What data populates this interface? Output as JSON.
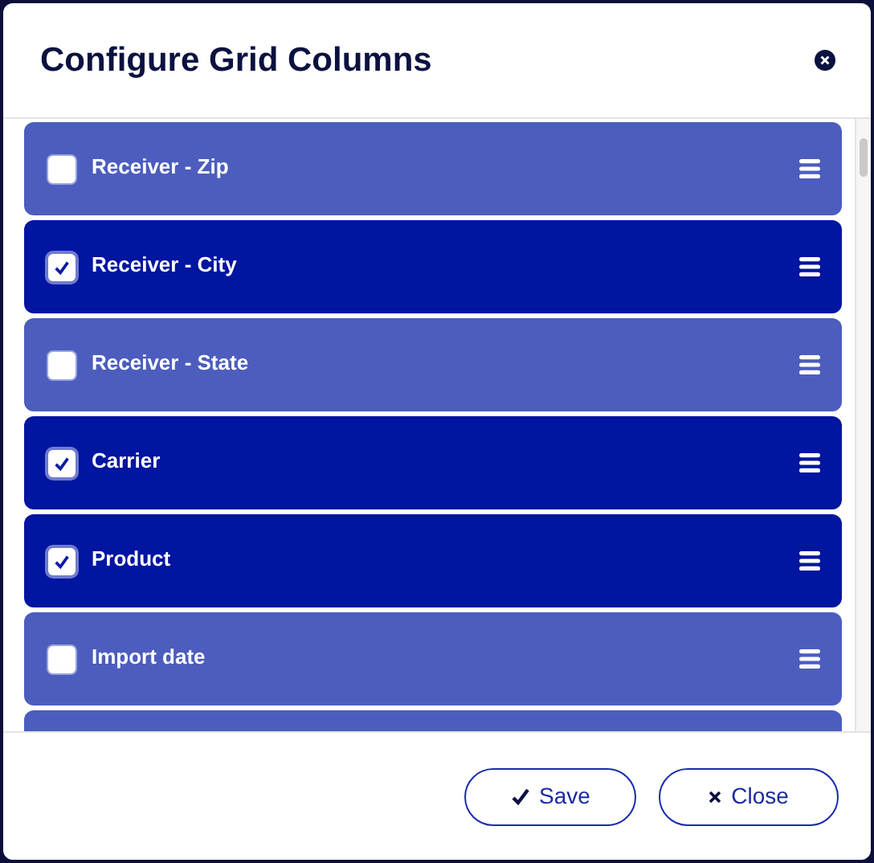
{
  "dialog": {
    "title": "Configure Grid Columns"
  },
  "columns": [
    {
      "kind": "row",
      "label": "Receiver - Zip",
      "checked": false
    },
    {
      "kind": "row",
      "label": "Receiver - City",
      "checked": true
    },
    {
      "kind": "row",
      "label": "Receiver - State",
      "checked": false
    },
    {
      "kind": "row",
      "label": "Carrier",
      "checked": true
    },
    {
      "kind": "row",
      "label": "Product",
      "checked": true
    },
    {
      "kind": "row",
      "label": "Import date",
      "checked": false
    },
    {
      "kind": "partial",
      "checked": false
    }
  ],
  "buttons": [
    {
      "kind": "save",
      "label": "Save"
    },
    {
      "kind": "close",
      "label": "Close"
    }
  ]
}
